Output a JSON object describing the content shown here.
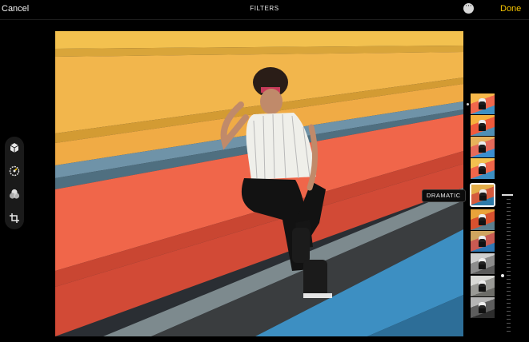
{
  "header": {
    "cancel_label": "Cancel",
    "title": "FILTERS",
    "more_icon": "ellipsis-circle-icon",
    "more_glyph": "···",
    "done_label": "Done",
    "done_color": "#f5c400"
  },
  "tools": [
    {
      "name": "cube-icon"
    },
    {
      "name": "adjust-dial-icon"
    },
    {
      "name": "filters-icon"
    },
    {
      "name": "crop-rotate-icon"
    }
  ],
  "filters": {
    "selected_label": "DRAMATIC",
    "selected_index": 4,
    "thumbnails": [
      {
        "tone": "vivid"
      },
      {
        "tone": "vivid-warm"
      },
      {
        "tone": "vivid-cool"
      },
      {
        "tone": "original"
      },
      {
        "tone": "dramatic"
      },
      {
        "tone": "dramatic-warm"
      },
      {
        "tone": "dramatic-cool"
      },
      {
        "tone": "mono"
      },
      {
        "tone": "silvertone"
      },
      {
        "tone": "noir"
      }
    ]
  },
  "intensity": {
    "value": 0.58
  }
}
